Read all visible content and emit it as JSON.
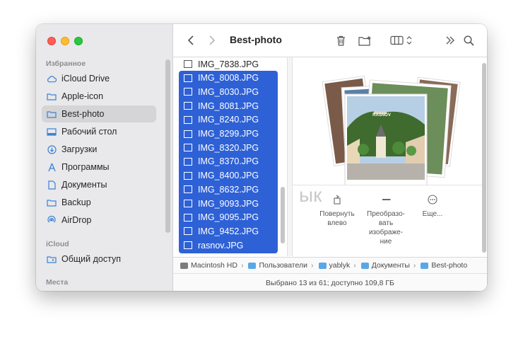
{
  "window": {
    "title": "Best-photo"
  },
  "sidebar": {
    "sections": [
      {
        "heading": "Избранное"
      },
      {
        "heading": "iCloud"
      },
      {
        "heading": "Места"
      }
    ],
    "favorites": [
      {
        "label": "iCloud Drive",
        "icon": "cloud-icon"
      },
      {
        "label": "Apple-icon",
        "icon": "folder-icon"
      },
      {
        "label": "Best-photo",
        "icon": "folder-icon",
        "selected": true
      },
      {
        "label": "Рабочий стол",
        "icon": "desktop-icon"
      },
      {
        "label": "Загрузки",
        "icon": "download-icon"
      },
      {
        "label": "Программы",
        "icon": "apps-icon"
      },
      {
        "label": "Документы",
        "icon": "document-icon"
      },
      {
        "label": "Backup",
        "icon": "folder-icon"
      },
      {
        "label": "AirDrop",
        "icon": "airdrop-icon"
      }
    ],
    "icloud": [
      {
        "label": "Общий доступ",
        "icon": "shared-folder-icon"
      }
    ]
  },
  "toolbar": {
    "back": "back-icon",
    "forward": "forward-icon",
    "trash": "trash-icon",
    "new_folder": "new-folder-icon",
    "view": "columns-view-icon",
    "more": "more-icon",
    "search": "search-icon"
  },
  "files": [
    {
      "name": "IMG_7838.JPG",
      "selected": false
    },
    {
      "name": "IMG_8008.JPG",
      "selected": true
    },
    {
      "name": "IMG_8030.JPG",
      "selected": true
    },
    {
      "name": "IMG_8081.JPG",
      "selected": true
    },
    {
      "name": "IMG_8240.JPG",
      "selected": true
    },
    {
      "name": "IMG_8299.JPG",
      "selected": true
    },
    {
      "name": "IMG_8320.JPG",
      "selected": true
    },
    {
      "name": "IMG_8370.JPG",
      "selected": true
    },
    {
      "name": "IMG_8400.JPG",
      "selected": true
    },
    {
      "name": "IMG_8632.JPG",
      "selected": true
    },
    {
      "name": "IMG_9093.JPG",
      "selected": true
    },
    {
      "name": "IMG_9095.JPG",
      "selected": true
    },
    {
      "name": "IMG_9452.JPG",
      "selected": true
    },
    {
      "name": "rasnov.JPG",
      "selected": true
    }
  ],
  "preview": {
    "sign_text": "RASNOV",
    "actions": [
      {
        "label_line1": "Повернуть",
        "label_line2": "влево",
        "label_line3": "",
        "icon": "rotate-left-icon"
      },
      {
        "label_line1": "Преобразо-",
        "label_line2": "вать",
        "label_line3": "изображе-",
        "label_line4": "ние",
        "icon": "markup-icon"
      },
      {
        "label_line1": "Еще...",
        "icon": "more-circle-icon"
      }
    ]
  },
  "pathbar": [
    "Macintosh HD",
    "Пользователи",
    "yablyk",
    "Документы",
    "Best-photo"
  ],
  "status": "Выбрано 13 из 61; доступно 109,8 ГБ",
  "watermark": "ык",
  "colors": {
    "selection": "#2e61d6",
    "sidebar_bg": "#e9e8ea",
    "folder": "#5aa7e6"
  }
}
